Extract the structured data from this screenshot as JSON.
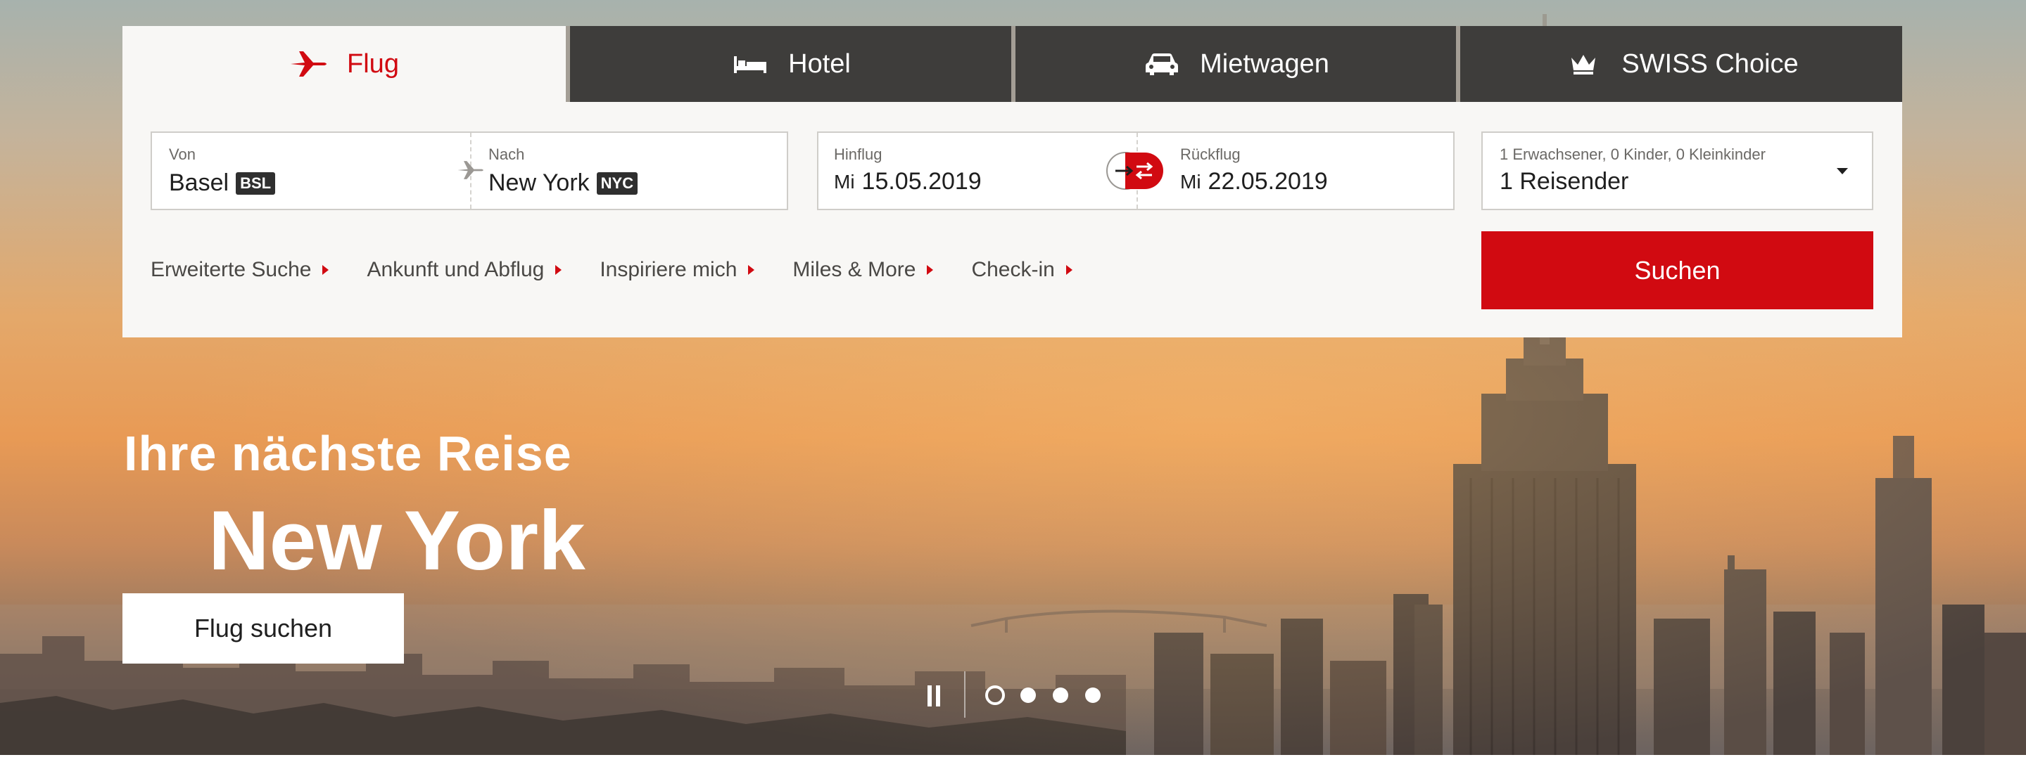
{
  "tabs": [
    {
      "label": "Flug",
      "icon": "plane-icon",
      "active": true
    },
    {
      "label": "Hotel",
      "icon": "bed-icon",
      "active": false
    },
    {
      "label": "Mietwagen",
      "icon": "car-icon",
      "active": false
    },
    {
      "label": "SWISS Choice",
      "icon": "crown-icon",
      "active": false
    }
  ],
  "route": {
    "from_label": "Von",
    "from_value": "Basel",
    "from_code": "BSL",
    "to_label": "Nach",
    "to_value": "New York",
    "to_code": "NYC"
  },
  "dates": {
    "outbound_label": "Hinflug",
    "outbound_day": "Mi",
    "outbound_date": "15.05.2019",
    "return_label": "Rückflug",
    "return_day": "Mi",
    "return_date": "22.05.2019"
  },
  "passengers": {
    "summary_label": "1 Erwachsener, 0 Kinder, 0 Kleinkinder",
    "value": "1 Reisender"
  },
  "links": [
    "Erweiterte Suche",
    "Ankunft und Abflug",
    "Inspiriere mich",
    "Miles & More",
    "Check-in"
  ],
  "search_button": "Suchen",
  "hero": {
    "subtitle": "Ihre nächste Reise",
    "title": "New York",
    "cta": "Flug suchen"
  },
  "carousel": {
    "slides": 4,
    "active": 1
  },
  "colors": {
    "accent": "#d10a11",
    "tab_dark": "#3e3d3b",
    "panel": "#f8f7f5"
  }
}
